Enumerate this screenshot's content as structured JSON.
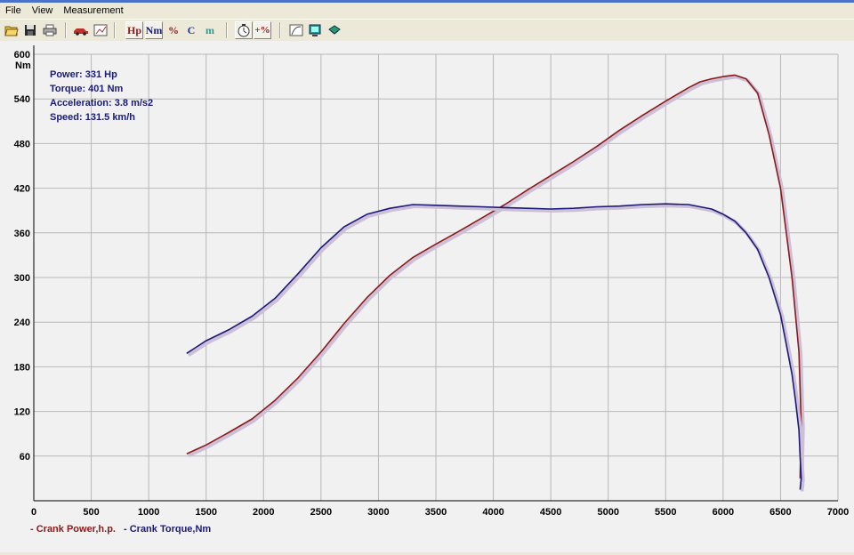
{
  "menu": {
    "items": [
      "File",
      "View",
      "Measurement"
    ]
  },
  "toolbar": {
    "buttons": [
      {
        "name": "open-icon"
      },
      {
        "name": "save-icon"
      },
      {
        "name": "print-icon"
      },
      {
        "name": "car-icon"
      },
      {
        "name": "graph-window-icon"
      },
      {
        "name": "hp-toggle",
        "label": "Hp"
      },
      {
        "name": "nm-toggle",
        "label": "Nm"
      },
      {
        "name": "percent-toggle",
        "label": "%"
      },
      {
        "name": "c-toggle",
        "label": "C"
      },
      {
        "name": "m-toggle",
        "label": "m"
      },
      {
        "name": "stopwatch-icon"
      },
      {
        "name": "plus-percent-toggle",
        "label": "+%"
      },
      {
        "name": "curve-icon"
      },
      {
        "name": "monitor-icon"
      },
      {
        "name": "diskette-icon"
      }
    ]
  },
  "readout": {
    "power": "Power: 331 Hp",
    "torque": "Torque: 401 Nm",
    "acceleration": "Acceleration: 3.8 m/s2",
    "speed": "Speed: 131.5 km/h"
  },
  "colors": {
    "power": "#8b1a1a",
    "torque": "#1a1a7a",
    "grid": "#b8b8b8",
    "plot_bg": "#f1f1f1"
  },
  "chart_data": {
    "type": "line",
    "y_unit_label": "Nm",
    "xlim": [
      0,
      7000
    ],
    "ylim": [
      0,
      600
    ],
    "x_ticks": [
      0,
      500,
      1000,
      1500,
      2000,
      2500,
      3000,
      3500,
      4000,
      4500,
      5000,
      5500,
      6000,
      6500,
      7000
    ],
    "y_ticks": [
      60,
      120,
      180,
      240,
      300,
      360,
      420,
      480,
      540,
      600
    ],
    "grid": true,
    "legend": "bottom-left",
    "series": [
      {
        "name": "- Crank Power,h.p.",
        "x": [
          1330,
          1400,
          1500,
          1700,
          1900,
          2100,
          2300,
          2500,
          2700,
          2900,
          3100,
          3300,
          3500,
          3700,
          3900,
          4100,
          4300,
          4500,
          4700,
          4900,
          5100,
          5300,
          5500,
          5700,
          5800,
          5900,
          6000,
          6100,
          6200,
          6300,
          6400,
          6500,
          6550,
          6600,
          6630,
          6660,
          6670,
          6680,
          6670
        ],
        "y": [
          63,
          68,
          75,
          92,
          110,
          135,
          165,
          200,
          238,
          273,
          303,
          327,
          345,
          362,
          380,
          398,
          418,
          437,
          456,
          476,
          498,
          518,
          537,
          555,
          563,
          567,
          570,
          572,
          567,
          548,
          492,
          420,
          360,
          300,
          250,
          200,
          150,
          100,
          30
        ]
      },
      {
        "name": "- Crank Torque,Nm",
        "x": [
          1330,
          1400,
          1500,
          1700,
          1900,
          2100,
          2300,
          2500,
          2700,
          2900,
          3100,
          3300,
          3500,
          3700,
          3900,
          4100,
          4300,
          4500,
          4700,
          4900,
          5100,
          5300,
          5500,
          5700,
          5900,
          6000,
          6100,
          6200,
          6300,
          6400,
          6500,
          6550,
          6600,
          6630,
          6660,
          6670,
          6680,
          6670
        ],
        "y": [
          198,
          205,
          215,
          230,
          248,
          272,
          305,
          340,
          368,
          385,
          393,
          398,
          397,
          396,
          395,
          394,
          393,
          392,
          393,
          395,
          396,
          398,
          399,
          398,
          392,
          385,
          376,
          360,
          338,
          300,
          250,
          210,
          170,
          135,
          95,
          60,
          30,
          15
        ]
      }
    ]
  }
}
